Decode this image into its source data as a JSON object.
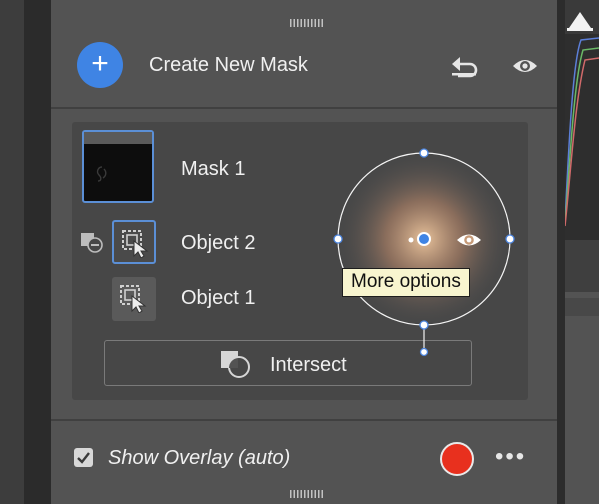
{
  "panel": {
    "header": {
      "add_icon": "plus-icon",
      "title": "Create New Mask",
      "undo_icon": "reset-icon",
      "visibility_icon": "eye-icon"
    },
    "mask": {
      "name": "Mask 1",
      "components": [
        {
          "name": "Object 2",
          "mode_icon": "subtract-icon",
          "selected": true
        },
        {
          "name": "Object 1",
          "selected": false
        }
      ],
      "intersect_label": "Intersect"
    },
    "footer": {
      "overlay_checked": true,
      "overlay_label": "Show Overlay (auto)",
      "overlay_color": "#e8301e",
      "more_icon": "ellipsis-icon"
    }
  },
  "canvas_widget": {
    "tooltip": "More options"
  },
  "colors": {
    "accent": "#3f84e4",
    "panel_bg": "#535353",
    "card_bg": "#474747",
    "selection": "#5b8fd6"
  }
}
